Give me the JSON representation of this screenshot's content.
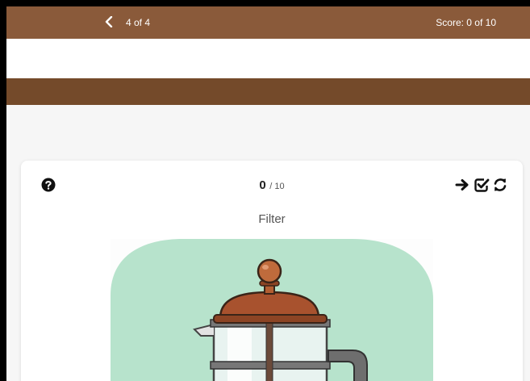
{
  "topbar": {
    "pager": "4 of 4",
    "score": "Score: 0 of 10"
  },
  "card": {
    "counter_value": "0",
    "counter_total": "/ 10",
    "label": "Filter"
  },
  "icons": {
    "back": "chevron-left-icon",
    "help": "question-circle-icon",
    "next": "arrow-right-icon",
    "check": "check-square-icon",
    "reset": "refresh-icon"
  },
  "colors": {
    "topbar": "#8a5a3a",
    "brownbar": "#744a2a",
    "illustration_bg": "#b7e3cc",
    "copper": "#a8522e"
  }
}
